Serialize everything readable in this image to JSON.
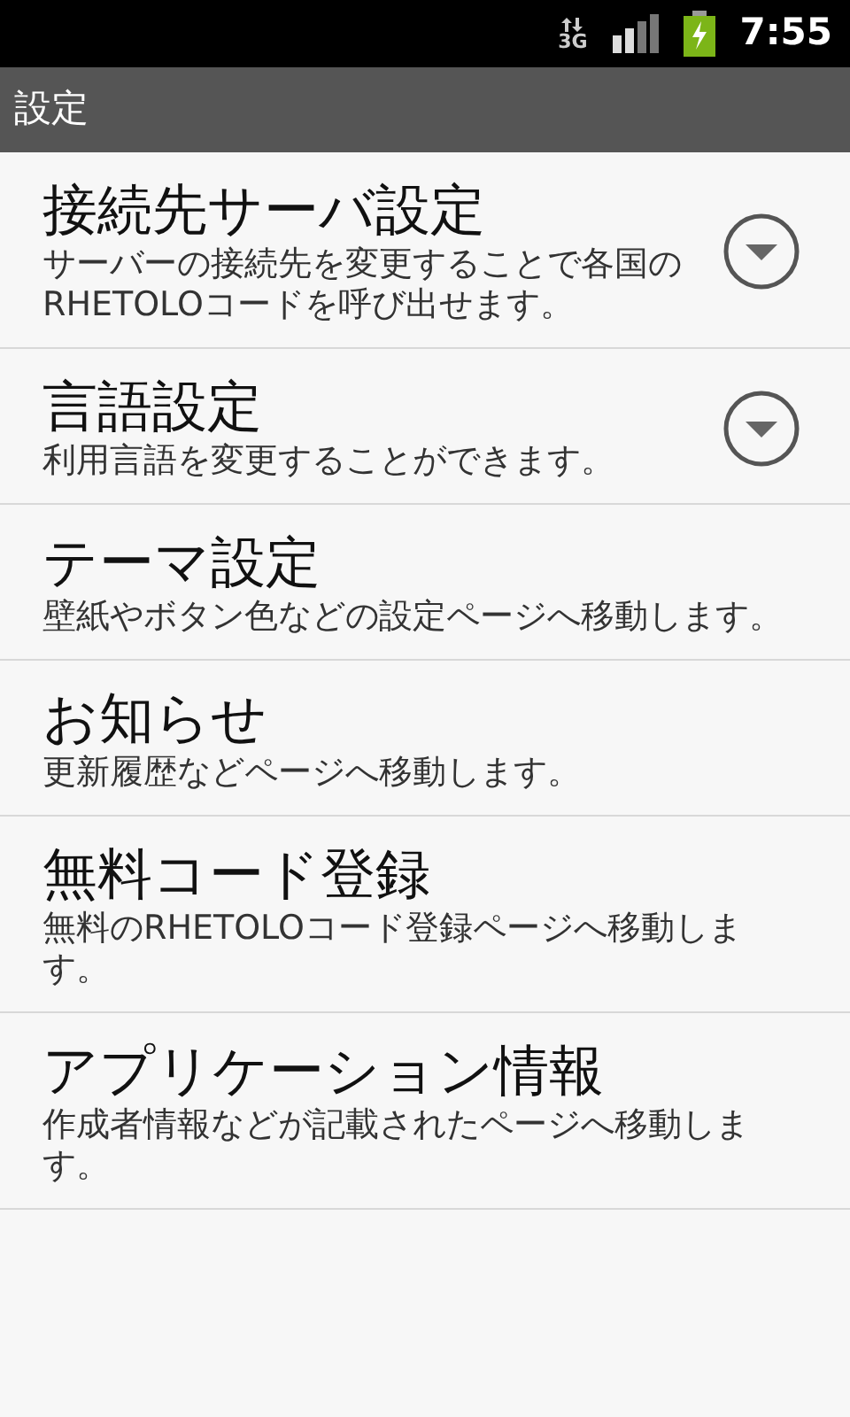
{
  "status_bar": {
    "network": "3G",
    "time": "7:55"
  },
  "title_bar": {
    "title": "設定"
  },
  "items": [
    {
      "kind": "dropdown",
      "title": "接続先サーバ設定",
      "description": "サーバーの接続先を変更することで各国のRHETOLOコードを呼び出せます。"
    },
    {
      "kind": "dropdown",
      "title": "言語設定",
      "description": "利用言語を変更することができます。"
    },
    {
      "kind": "link",
      "title": "テーマ設定",
      "description": "壁紙やボタン色などの設定ページへ移動します。"
    },
    {
      "kind": "link",
      "title": "お知らせ",
      "description": "更新履歴などページへ移動します。"
    },
    {
      "kind": "link",
      "title": "無料コード登録",
      "description": "無料のRHETOLOコード登録ページへ移動します。"
    },
    {
      "kind": "link",
      "title": "アプリケーション情報",
      "description": "作成者情報などが記載されたページへ移動します。"
    }
  ]
}
